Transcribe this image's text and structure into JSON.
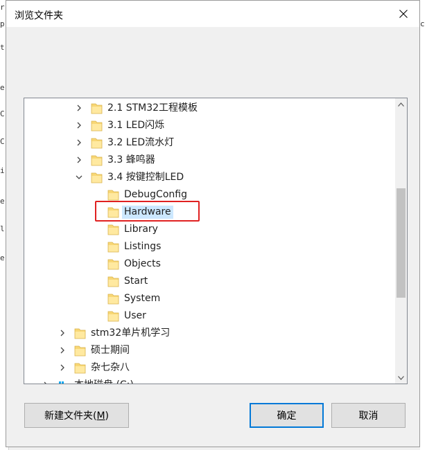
{
  "background": {
    "left_fragments": [
      "r",
      "p",
      "t",
      "e",
      "C",
      "C",
      "i",
      "e",
      "l",
      "e"
    ],
    "right_fragment": "c"
  },
  "dialog": {
    "title": "浏览文件夹",
    "close_icon": "close-icon",
    "tree": {
      "items": [
        {
          "label": "2.1  STM32工程模板",
          "expanded": false,
          "selected": false
        },
        {
          "label": "3.1  LED闪烁",
          "expanded": false,
          "selected": false
        },
        {
          "label": "3.2  LED流水灯",
          "expanded": false,
          "selected": false
        },
        {
          "label": "3.3  蜂鸣器",
          "expanded": false,
          "selected": false
        },
        {
          "label": "3.4  按键控制LED",
          "expanded": true,
          "selected": false
        },
        {
          "label": "DebugConfig",
          "selected": false
        },
        {
          "label": "Hardware",
          "selected": true
        },
        {
          "label": "Library",
          "selected": false
        },
        {
          "label": "Listings",
          "selected": false
        },
        {
          "label": "Objects",
          "selected": false
        },
        {
          "label": "Start",
          "selected": false
        },
        {
          "label": "System",
          "selected": false
        },
        {
          "label": "User",
          "selected": false
        },
        {
          "label": "stm32单片机学习",
          "expanded": false,
          "selected": false
        },
        {
          "label": "硕士期间",
          "expanded": false,
          "selected": false
        },
        {
          "label": "杂七杂八",
          "expanded": false,
          "selected": false
        },
        {
          "label": "本地磁盘 (C:)",
          "expanded": false,
          "selected": false
        }
      ]
    },
    "buttons": {
      "new_folder": "新建文件夹(",
      "new_folder_key": "M",
      "new_folder_end": ")",
      "ok": "确定",
      "cancel": "取消"
    },
    "colors": {
      "selection": "#cce8ff",
      "highlight_box": "#e02020",
      "folder": "#f8d775",
      "default_button_border": "#0078d7"
    }
  }
}
